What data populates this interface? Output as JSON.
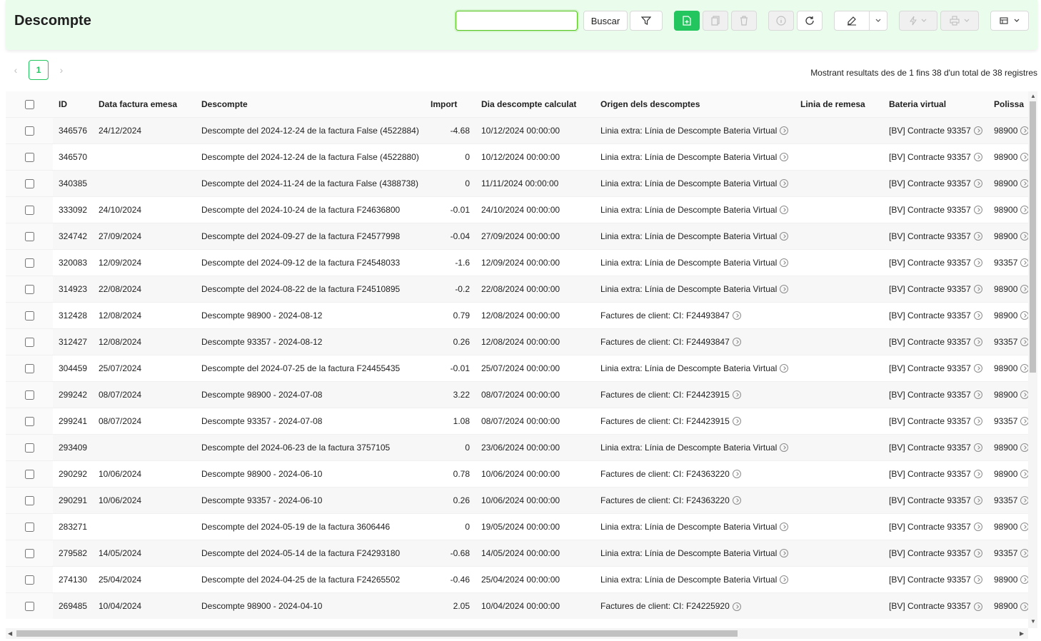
{
  "title": "Descompte",
  "search": {
    "value": "",
    "button_label": "Buscar"
  },
  "pagination": {
    "current": "1"
  },
  "summary": "Mostrant resultats des de 1 fins 38 d'un total de 38 registres",
  "columns": [
    "ID",
    "Data factura emesa",
    "Descompte",
    "Import",
    "Dia descompte calculat",
    "Origen dels descomptes",
    "Linia de remesa",
    "Bateria virtual",
    "Polissa"
  ],
  "rows": [
    {
      "id": "346576",
      "date": "24/12/2024",
      "desc": "Descompte del 2024-12-24 de la factura False (4522884)",
      "import": "-4.68",
      "calc": "10/12/2024 00:00:00",
      "origen": "Linia extra: Línia de Descompte Bateria Virtual",
      "remesa": "",
      "bateria": "[BV] Contracte 93357",
      "polissa": "98900"
    },
    {
      "id": "346570",
      "date": "",
      "desc": "Descompte del 2024-12-24 de la factura False (4522880)",
      "import": "0",
      "calc": "10/12/2024 00:00:00",
      "origen": "Linia extra: Línia de Descompte Bateria Virtual",
      "remesa": "",
      "bateria": "[BV] Contracte 93357",
      "polissa": "98900"
    },
    {
      "id": "340385",
      "date": "",
      "desc": "Descompte del 2024-11-24 de la factura False (4388738)",
      "import": "0",
      "calc": "11/11/2024 00:00:00",
      "origen": "Linia extra: Línia de Descompte Bateria Virtual",
      "remesa": "",
      "bateria": "[BV] Contracte 93357",
      "polissa": "98900"
    },
    {
      "id": "333092",
      "date": "24/10/2024",
      "desc": "Descompte del 2024-10-24 de la factura F24636800",
      "import": "-0.01",
      "calc": "24/10/2024 00:00:00",
      "origen": "Linia extra: Línia de Descompte Bateria Virtual",
      "remesa": "",
      "bateria": "[BV] Contracte 93357",
      "polissa": "98900"
    },
    {
      "id": "324742",
      "date": "27/09/2024",
      "desc": "Descompte del 2024-09-27 de la factura F24577998",
      "import": "-0.04",
      "calc": "27/09/2024 00:00:00",
      "origen": "Linia extra: Línia de Descompte Bateria Virtual",
      "remesa": "",
      "bateria": "[BV] Contracte 93357",
      "polissa": "98900"
    },
    {
      "id": "320083",
      "date": "12/09/2024",
      "desc": "Descompte del 2024-09-12 de la factura F24548033",
      "import": "-1.6",
      "calc": "12/09/2024 00:00:00",
      "origen": "Linia extra: Línia de Descompte Bateria Virtual",
      "remesa": "",
      "bateria": "[BV] Contracte 93357",
      "polissa": "93357"
    },
    {
      "id": "314923",
      "date": "22/08/2024",
      "desc": "Descompte del 2024-08-22 de la factura F24510895",
      "import": "-0.2",
      "calc": "22/08/2024 00:00:00",
      "origen": "Linia extra: Línia de Descompte Bateria Virtual",
      "remesa": "",
      "bateria": "[BV] Contracte 93357",
      "polissa": "98900"
    },
    {
      "id": "312428",
      "date": "12/08/2024",
      "desc": "Descompte 98900 - 2024-08-12",
      "import": "0.79",
      "calc": "12/08/2024 00:00:00",
      "origen": "Factures de client: CI: F24493847",
      "remesa": "",
      "bateria": "[BV] Contracte 93357",
      "polissa": "98900"
    },
    {
      "id": "312427",
      "date": "12/08/2024",
      "desc": "Descompte 93357 - 2024-08-12",
      "import": "0.26",
      "calc": "12/08/2024 00:00:00",
      "origen": "Factures de client: CI: F24493847",
      "remesa": "",
      "bateria": "[BV] Contracte 93357",
      "polissa": "93357"
    },
    {
      "id": "304459",
      "date": "25/07/2024",
      "desc": "Descompte del 2024-07-25 de la factura F24455435",
      "import": "-0.01",
      "calc": "25/07/2024 00:00:00",
      "origen": "Linia extra: Línia de Descompte Bateria Virtual",
      "remesa": "",
      "bateria": "[BV] Contracte 93357",
      "polissa": "98900"
    },
    {
      "id": "299242",
      "date": "08/07/2024",
      "desc": "Descompte 98900 - 2024-07-08",
      "import": "3.22",
      "calc": "08/07/2024 00:00:00",
      "origen": "Factures de client: CI: F24423915",
      "remesa": "",
      "bateria": "[BV] Contracte 93357",
      "polissa": "98900"
    },
    {
      "id": "299241",
      "date": "08/07/2024",
      "desc": "Descompte 93357 - 2024-07-08",
      "import": "1.08",
      "calc": "08/07/2024 00:00:00",
      "origen": "Factures de client: CI: F24423915",
      "remesa": "",
      "bateria": "[BV] Contracte 93357",
      "polissa": "93357"
    },
    {
      "id": "293409",
      "date": "",
      "desc": "Descompte del 2024-06-23 de la factura 3757105",
      "import": "0",
      "calc": "23/06/2024 00:00:00",
      "origen": "Linia extra: Línia de Descompte Bateria Virtual",
      "remesa": "",
      "bateria": "[BV] Contracte 93357",
      "polissa": "98900"
    },
    {
      "id": "290292",
      "date": "10/06/2024",
      "desc": "Descompte 98900 - 2024-06-10",
      "import": "0.78",
      "calc": "10/06/2024 00:00:00",
      "origen": "Factures de client: CI: F24363220",
      "remesa": "",
      "bateria": "[BV] Contracte 93357",
      "polissa": "98900"
    },
    {
      "id": "290291",
      "date": "10/06/2024",
      "desc": "Descompte 93357 - 2024-06-10",
      "import": "0.26",
      "calc": "10/06/2024 00:00:00",
      "origen": "Factures de client: CI: F24363220",
      "remesa": "",
      "bateria": "[BV] Contracte 93357",
      "polissa": "93357"
    },
    {
      "id": "283271",
      "date": "",
      "desc": "Descompte del 2024-05-19 de la factura 3606446",
      "import": "0",
      "calc": "19/05/2024 00:00:00",
      "origen": "Linia extra: Línia de Descompte Bateria Virtual",
      "remesa": "",
      "bateria": "[BV] Contracte 93357",
      "polissa": "98900"
    },
    {
      "id": "279582",
      "date": "14/05/2024",
      "desc": "Descompte del 2024-05-14 de la factura F24293180",
      "import": "-0.68",
      "calc": "14/05/2024 00:00:00",
      "origen": "Linia extra: Línia de Descompte Bateria Virtual",
      "remesa": "",
      "bateria": "[BV] Contracte 93357",
      "polissa": "93357"
    },
    {
      "id": "274130",
      "date": "25/04/2024",
      "desc": "Descompte del 2024-04-25 de la factura F24265502",
      "import": "-0.46",
      "calc": "25/04/2024 00:00:00",
      "origen": "Linia extra: Línia de Descompte Bateria Virtual",
      "remesa": "",
      "bateria": "[BV] Contracte 93357",
      "polissa": "98900"
    },
    {
      "id": "269485",
      "date": "10/04/2024",
      "desc": "Descompte 98900 - 2024-04-10",
      "import": "2.05",
      "calc": "10/04/2024 00:00:00",
      "origen": "Factures de client: CI: F24225920",
      "remesa": "",
      "bateria": "[BV] Contracte 93357",
      "polissa": "98900"
    }
  ],
  "colors": {
    "accent": "#22c55e",
    "header_bg": "#eafcec"
  },
  "icons": [
    "filter-icon",
    "new-document-icon",
    "copy-icon",
    "delete-icon",
    "info-icon",
    "refresh-icon",
    "edit-icon",
    "chevron-down-icon",
    "action-icon",
    "print-icon",
    "view-icon"
  ]
}
